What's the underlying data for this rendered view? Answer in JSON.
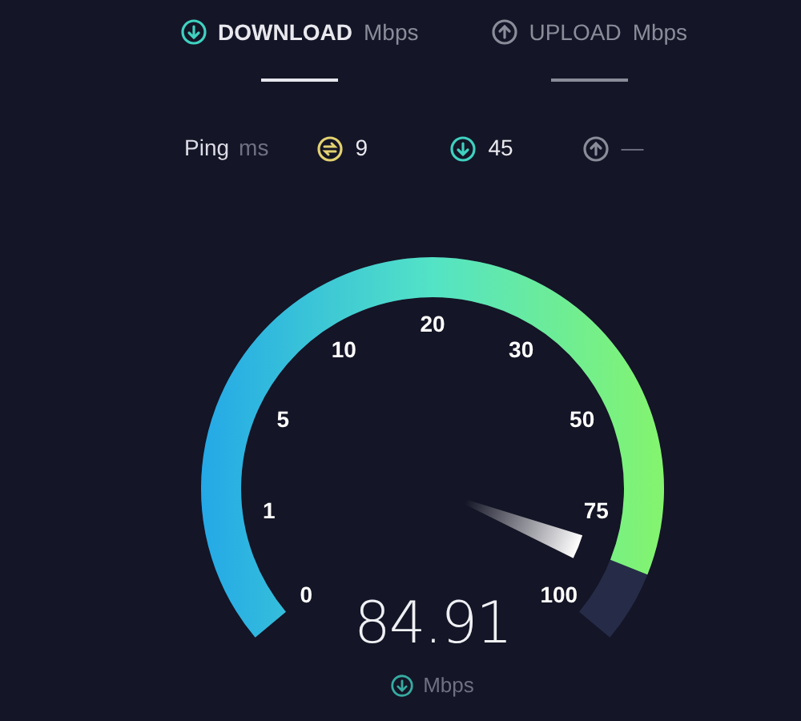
{
  "tabs": [
    {
      "kind": "download",
      "label": "DOWNLOAD",
      "unit": "Mbps",
      "selected": true
    },
    {
      "kind": "upload",
      "label": "UPLOAD",
      "unit": "Mbps",
      "selected": false
    }
  ],
  "ping": {
    "label": "Ping",
    "unit": "ms",
    "stats": [
      {
        "kind": "ping",
        "value": "9"
      },
      {
        "kind": "download",
        "value": "45"
      },
      {
        "kind": "upload",
        "value": "—"
      }
    ]
  },
  "gauge": {
    "ticks": [
      "0",
      "1",
      "5",
      "10",
      "20",
      "30",
      "50",
      "75",
      "100"
    ],
    "reading": "84.91",
    "unit": "Mbps",
    "kind": "download"
  }
}
